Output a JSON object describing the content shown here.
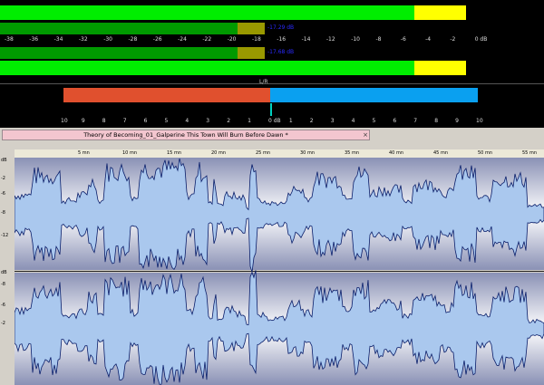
{
  "peak_meter": {
    "left_level": "-17.29 dB",
    "right_level": "-17.68 dB",
    "scale_labels": [
      "-38",
      "-36",
      "-34",
      "-32",
      "-30",
      "-28",
      "-26",
      "-24",
      "-22",
      "-20",
      "-18",
      "-16",
      "-14",
      "-12",
      "-10",
      "-8",
      "-6",
      "-4",
      "-2",
      "0 dB"
    ],
    "colors": {
      "green": "#00ee00",
      "dark_green": "#009a00",
      "hold": "#999900",
      "yellow": "#ffff00"
    }
  },
  "phase_meter": {
    "marker": "L/R",
    "scale_labels": [
      "10",
      "9",
      "8",
      "7",
      "6",
      "5",
      "4",
      "3",
      "2",
      "1",
      "0 dB",
      "1",
      "2",
      "3",
      "4",
      "5",
      "6",
      "7",
      "8",
      "9",
      "10"
    ],
    "colors": {
      "left": "#e0502e",
      "right": "#0aa0f0",
      "cursor": "#00d0c0"
    }
  },
  "document": {
    "tab_title": "Theory of Becoming_01_Galperine  This Town Will Burn Before Dawn *",
    "close_label": "×"
  },
  "waveform": {
    "colors": {
      "fill": "#aac8ee",
      "outline": "#0a1e6a",
      "bg_edge": "#8a91b5",
      "bg_center": "#ffffff"
    },
    "channel_top_label": "dB",
    "channel_bottom_label": "dB",
    "ruler_labels": [
      "5 mn",
      "10 mn",
      "15 mn",
      "20 mn",
      "25 mn",
      "30 mn",
      "35 mn",
      "40 mn",
      "45 mn",
      "50 mn",
      "55 mn"
    ],
    "y_labels": [
      "-2",
      "-6",
      "-8",
      "-12",
      "-8",
      "-6",
      "-2"
    ]
  }
}
